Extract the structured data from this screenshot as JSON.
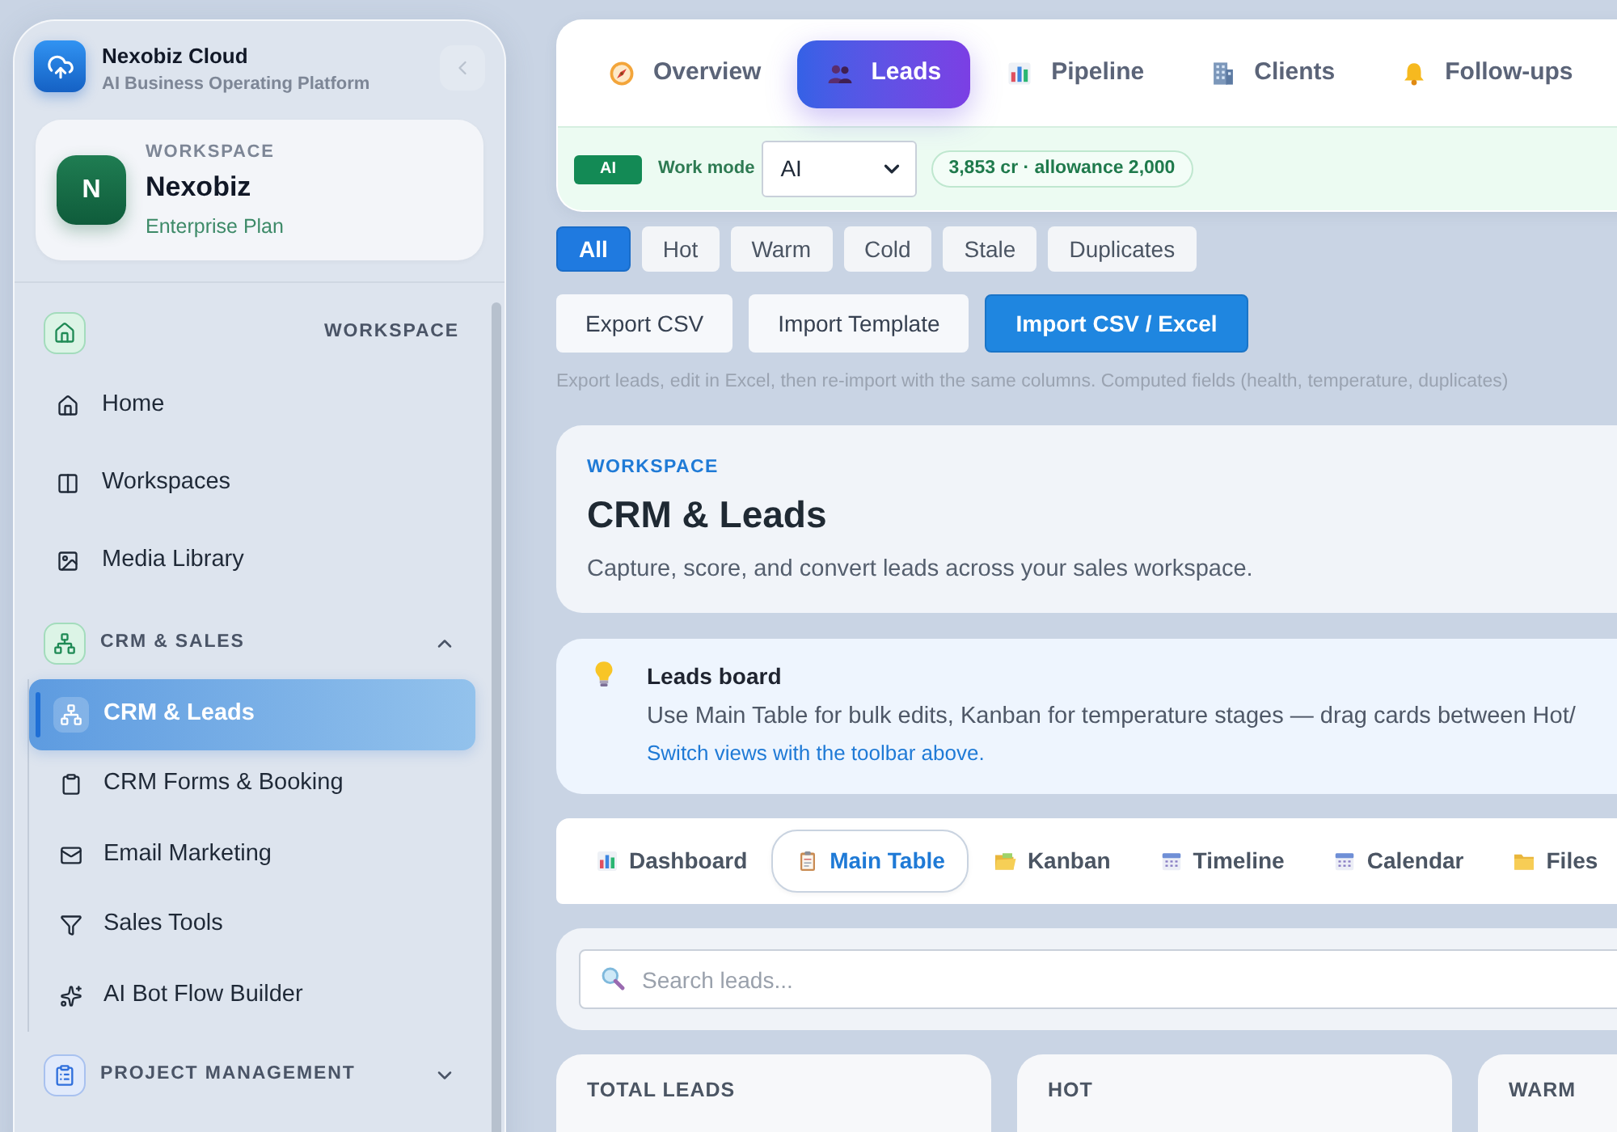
{
  "sidebar": {
    "brand": {
      "name": "Nexobiz Cloud",
      "tagline": "AI Business Operating Platform"
    },
    "workspace_card": {
      "label": "WORKSPACE",
      "initial": "N",
      "name": "Nexobiz",
      "plan": "Enterprise Plan"
    },
    "sections": [
      {
        "title": "WORKSPACE",
        "kind": "label",
        "items": [
          {
            "label": "Home",
            "selected": false
          },
          {
            "label": "Workspaces",
            "selected": false
          },
          {
            "label": "Media Library",
            "selected": false
          }
        ]
      },
      {
        "title": "CRM & SALES",
        "kind": "group",
        "expanded": true,
        "items": [
          {
            "label": "CRM & Leads",
            "selected": true
          },
          {
            "label": "CRM Forms & Booking",
            "selected": false
          },
          {
            "label": "Email Marketing",
            "selected": false
          },
          {
            "label": "Sales Tools",
            "selected": false
          },
          {
            "label": "AI Bot Flow Builder",
            "selected": false
          }
        ]
      },
      {
        "title": "PROJECT MANAGEMENT",
        "kind": "group",
        "expanded": false
      }
    ]
  },
  "top_tabs": [
    {
      "label": "Overview",
      "selected": false
    },
    {
      "label": "Leads",
      "selected": true
    },
    {
      "label": "Pipeline",
      "selected": false
    },
    {
      "label": "Clients",
      "selected": false
    },
    {
      "label": "Follow-ups",
      "selected": false
    }
  ],
  "work_mode": {
    "badge": "AI",
    "label": "Work mode",
    "value": "AI",
    "credits": "3,853 cr · allowance 2,000"
  },
  "filters": [
    {
      "label": "All",
      "selected": true
    },
    {
      "label": "Hot",
      "selected": false
    },
    {
      "label": "Warm",
      "selected": false
    },
    {
      "label": "Cold",
      "selected": false
    },
    {
      "label": "Stale",
      "selected": false
    },
    {
      "label": "Duplicates",
      "selected": false
    }
  ],
  "actions": [
    {
      "label": "Export CSV",
      "kind": "secondary"
    },
    {
      "label": "Import Template",
      "kind": "secondary"
    },
    {
      "label": "Import CSV / Excel",
      "kind": "primary"
    }
  ],
  "import_hint": "Export leads, edit in Excel, then re-import with the same columns. Computed fields (health, temperature, duplicates)",
  "header": {
    "eyebrow": "WORKSPACE",
    "title": "CRM & Leads",
    "description": "Capture, score, and convert leads across your sales workspace."
  },
  "tip": {
    "title": "Leads board",
    "body": "Use Main Table for bulk edits, Kanban for temperature stages — drag cards between Hot/",
    "link": "Switch views with the toolbar above."
  },
  "view_tabs": [
    {
      "label": "Dashboard",
      "selected": false
    },
    {
      "label": "Main Table",
      "selected": true
    },
    {
      "label": "Kanban",
      "selected": false
    },
    {
      "label": "Timeline",
      "selected": false
    },
    {
      "label": "Calendar",
      "selected": false
    },
    {
      "label": "Files",
      "selected": false
    }
  ],
  "search": {
    "placeholder": "Search leads..."
  },
  "stats": [
    {
      "label": "TOTAL LEADS"
    },
    {
      "label": "HOT"
    },
    {
      "label": "WARM"
    }
  ]
}
